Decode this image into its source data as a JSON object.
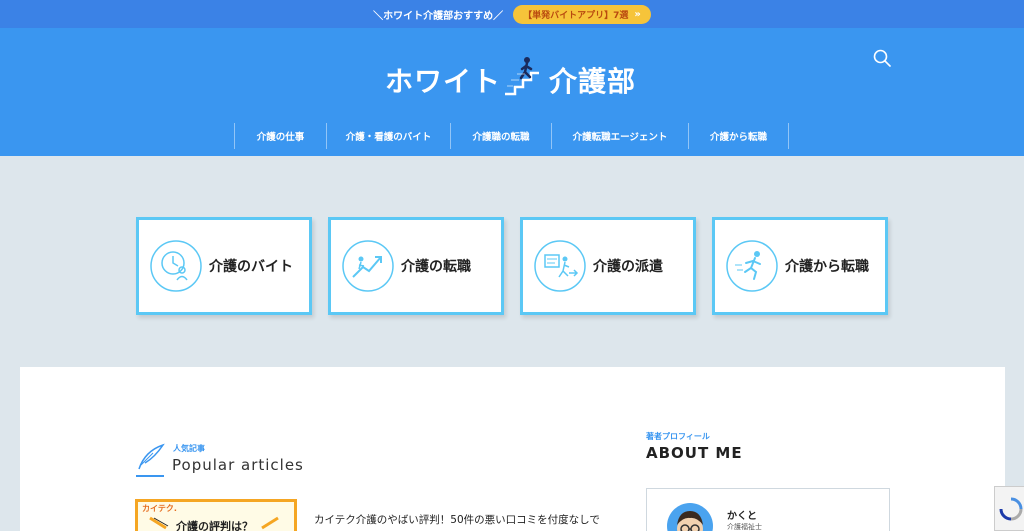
{
  "topbar": {
    "text": "＼ホワイト介護部おすすめ／",
    "pill_label": "【単発バイトアプリ】7選",
    "pill_arrow": "»"
  },
  "logo": {
    "left_text": "ホワイト",
    "right_text": "介護部"
  },
  "nav": {
    "items": [
      "介護の仕事",
      "介護・看護のバイト",
      "介護職の転職",
      "介護転職エージェント",
      "介護から転職"
    ]
  },
  "cards": [
    {
      "label": "介護のバイト",
      "icon": "clock-person-icon"
    },
    {
      "label": "介護の転職",
      "icon": "career-stairs-icon"
    },
    {
      "label": "介護の派遣",
      "icon": "dispatch-icon"
    },
    {
      "label": "介護から転職",
      "icon": "running-person-icon"
    }
  ],
  "popular": {
    "subtitle": "人気記事",
    "title": "Popular articles",
    "thumb_badge": "カイテク.",
    "thumb_title": "介護の評判は？",
    "article_title": "カイテク介護のやばい評判！50件の悪い口コミを付度なしで"
  },
  "about": {
    "subtitle": "著者プロフィール",
    "title": "ABOUT ME",
    "name": "かくと",
    "role": "介護福祉士"
  },
  "colors": {
    "topbar": "#3b82e6",
    "header": "#3a96f0",
    "card_border": "#5bc8f5",
    "accent_orange": "#f5a623"
  }
}
